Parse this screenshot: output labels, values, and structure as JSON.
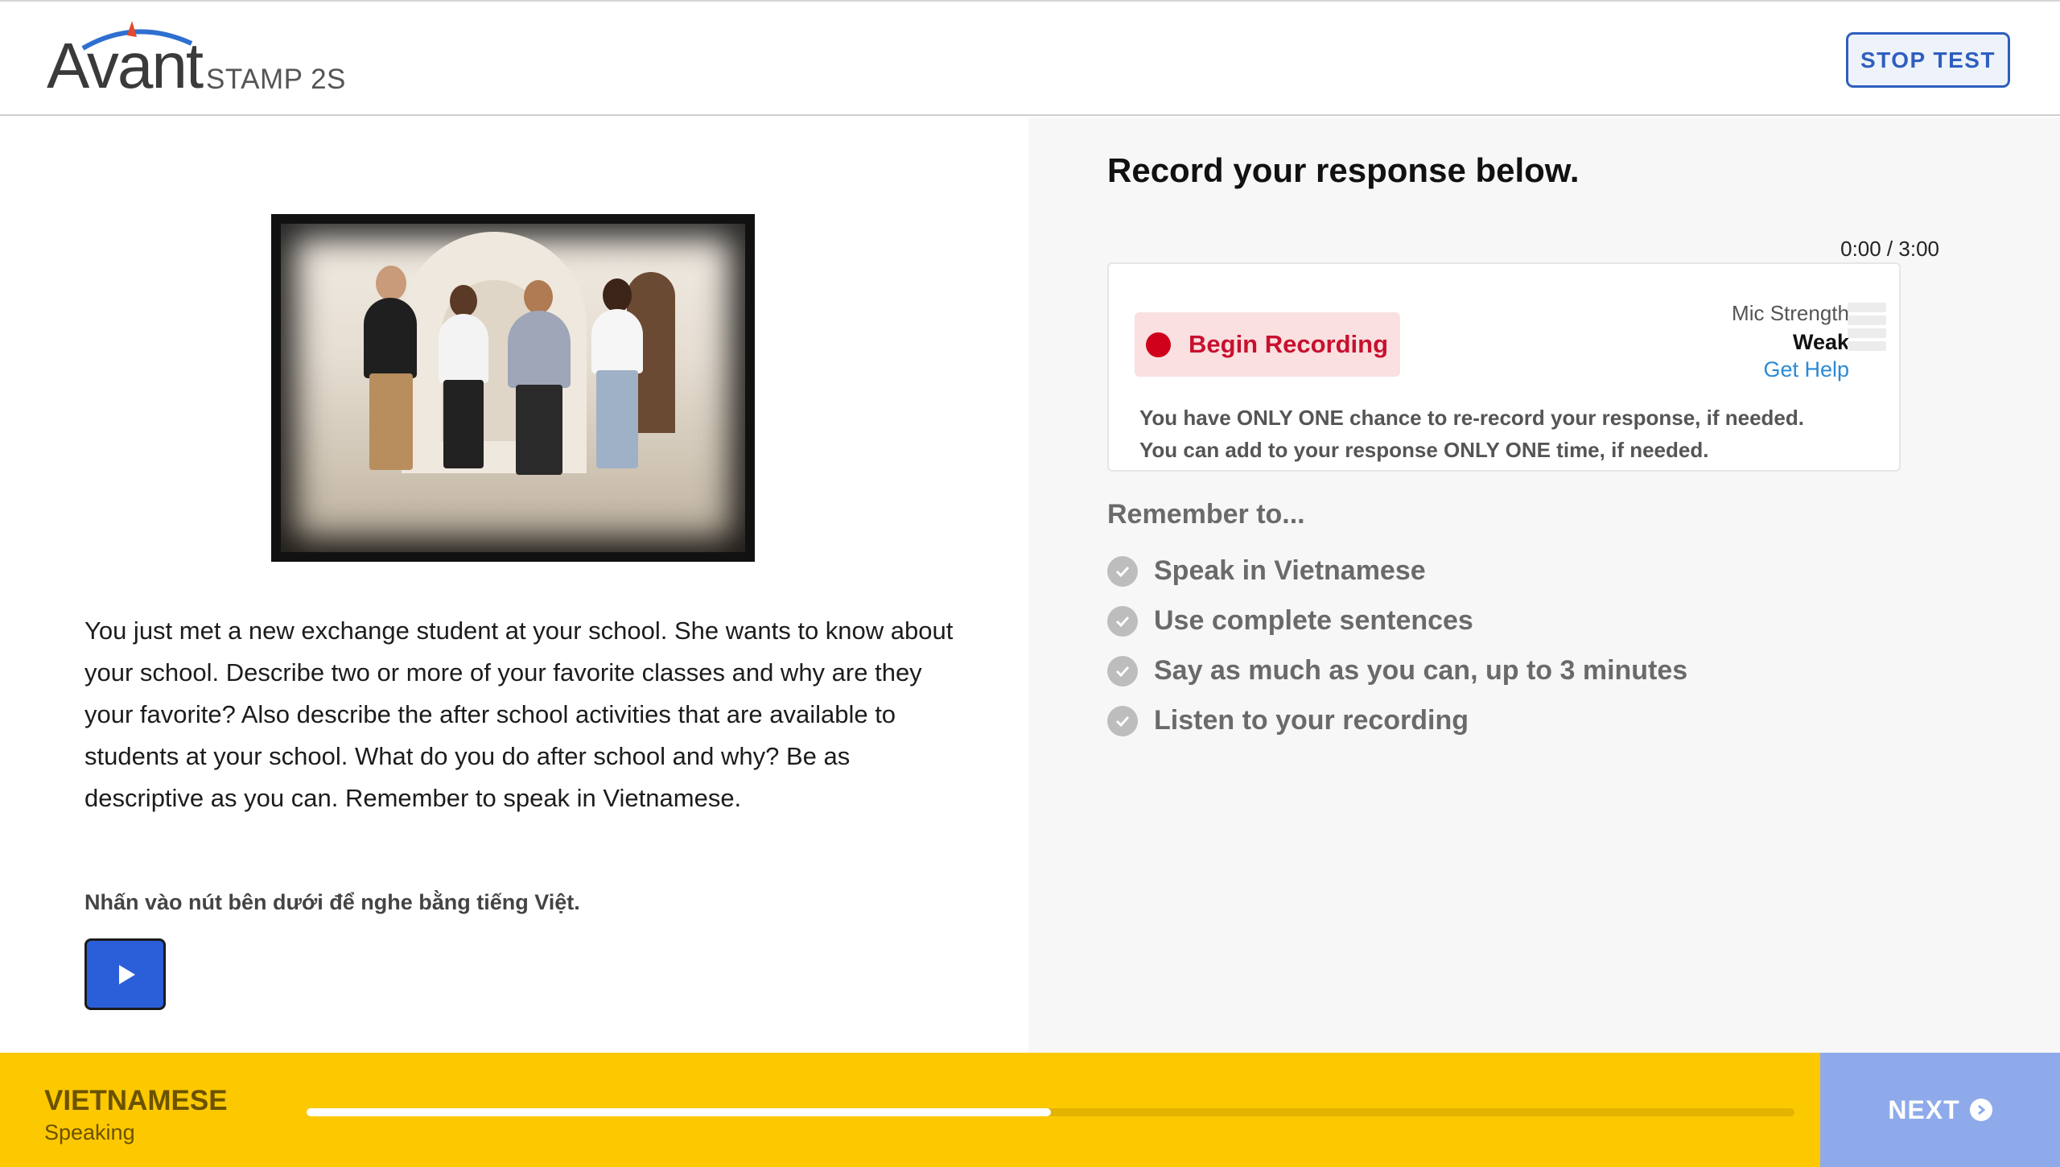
{
  "header": {
    "logo_text": "Avant",
    "product_name": "STAMP 2S",
    "stop_test_label": "STOP TEST"
  },
  "prompt": {
    "text": "You just met a new exchange student at your school. She wants to know about your school. Describe two or more of your favorite classes and why are they your favorite? Also describe the after school activities that are available to students at your school. What do you do after school and why? Be as descriptive as you can. Remember to speak in Vietnamese.",
    "listen_label": "Nhấn vào nút bên dưới để nghe bằng tiếng Việt."
  },
  "recorder": {
    "title": "Record your response below.",
    "timer": "0:00 / 3:00",
    "begin_label": "Begin Recording",
    "mic_strength_label": "Mic Strength",
    "mic_strength_value": "Weak",
    "mic_level": 0,
    "get_help_label": "Get Help",
    "note_1": "You have ONLY ONE chance to re-record your response, if needed.",
    "note_2": "You can add to your response ONLY ONE time, if needed."
  },
  "reminders": {
    "title": "Remember to...",
    "items": [
      "Speak in Vietnamese",
      "Use complete sentences",
      "Say as much as you can, up to 3 minutes",
      "Listen to your recording"
    ]
  },
  "footer": {
    "language": "VIETNAMESE",
    "section": "Speaking",
    "progress": 0.5,
    "next_label": "NEXT"
  },
  "colors": {
    "accent_blue": "#2e5fbf",
    "record_red": "#d0021b",
    "footer_yellow": "#fcc800",
    "next_blue": "#8eaaeb",
    "link_blue": "#2b8ad6"
  }
}
